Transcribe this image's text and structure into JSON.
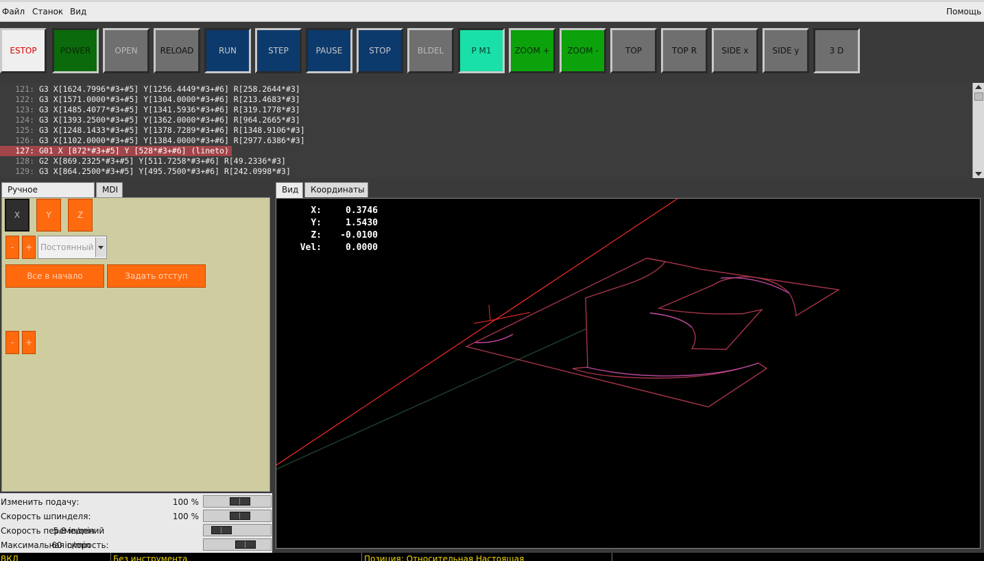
{
  "menu": {
    "file": "Файл",
    "machine": "Станок",
    "view": "Вид",
    "help": "Помощь"
  },
  "toolbar": [
    {
      "label": "ESTOP",
      "bg": "#efefef",
      "fg": "#e00000",
      "sunk": false
    },
    {
      "label": "POWER",
      "bg": "#0b6a0b",
      "fg": "#0a2a0a",
      "sunk": true
    },
    {
      "label": "OPEN",
      "bg": "#6f6f6f",
      "fg": "#b9b9b9",
      "sunk": false
    },
    {
      "label": "RELOAD",
      "bg": "#6f6f6f",
      "fg": "#111111",
      "sunk": false
    },
    {
      "label": "RUN",
      "bg": "#0d3a6d",
      "fg": "#c8c8c8",
      "sunk": true
    },
    {
      "label": "STEP",
      "bg": "#0d3a6d",
      "fg": "#c8c8c8",
      "sunk": false
    },
    {
      "label": "PAUSE",
      "bg": "#0d3a6d",
      "fg": "#c8c8c8",
      "sunk": true
    },
    {
      "label": "STOP",
      "bg": "#0d3a6d",
      "fg": "#c8c8c8",
      "sunk": false
    },
    {
      "label": "BLDEL",
      "bg": "#6f6f6f",
      "fg": "#b9b9b9",
      "sunk": false
    },
    {
      "label": "P M1",
      "bg": "#19e0a8",
      "fg": "#0a3a2a",
      "sunk": true
    },
    {
      "label": "ZOOM +",
      "bg": "#0ca20c",
      "fg": "#0a2a0a",
      "sunk": false
    },
    {
      "label": "ZOOM -",
      "bg": "#0ca20c",
      "fg": "#0a2a0a",
      "sunk": false
    },
    {
      "label": "TOP",
      "bg": "#6f6f6f",
      "fg": "#111111",
      "sunk": false
    },
    {
      "label": "TOP R",
      "bg": "#6f6f6f",
      "fg": "#111111",
      "sunk": false
    },
    {
      "label": "SIDE x",
      "bg": "#6f6f6f",
      "fg": "#111111",
      "sunk": false
    },
    {
      "label": "SIDE y",
      "bg": "#6f6f6f",
      "fg": "#111111",
      "sunk": false
    },
    {
      "label": "3 D",
      "bg": "#6f6f6f",
      "fg": "#111111",
      "sunk": true
    }
  ],
  "gcode": [
    {
      "num": "121:",
      "text": "G3 X[1624.7996*#3+#5] Y[1256.4449*#3+#6] R[258.2644*#3]",
      "active": false
    },
    {
      "num": "122:",
      "text": "G3 X[1571.0000*#3+#5] Y[1304.0000*#3+#6] R[213.4683*#3]",
      "active": false
    },
    {
      "num": "123:",
      "text": "G3 X[1485.4077*#3+#5] Y[1341.5936*#3+#6] R[319.1778*#3]",
      "active": false
    },
    {
      "num": "124:",
      "text": "G3 X[1393.2500*#3+#5] Y[1362.0000*#3+#6] R[964.2665*#3]",
      "active": false
    },
    {
      "num": "125:",
      "text": "G3 X[1248.1433*#3+#5] Y[1378.7289*#3+#6] R[1348.9106*#3]",
      "active": false
    },
    {
      "num": "126:",
      "text": "G3 X[1102.0000*#3+#5] Y[1384.0000*#3+#6] R[2977.6386*#3]",
      "active": false
    },
    {
      "num": "127:",
      "text": "G01 X [872*#3+#5] Y [528*#3+#6] (lineto)",
      "active": true
    },
    {
      "num": "128:",
      "text": "G2 X[869.2325*#3+#5] Y[511.7258*#3+#6] R[49.2336*#3]",
      "active": false
    },
    {
      "num": "129:",
      "text": "G3 X[864.2500*#3+#5] Y[495.7500*#3+#6] R[242.0998*#3]",
      "active": false
    }
  ],
  "left_tabs": {
    "manual": "Ручное управление",
    "mdi": "MDI"
  },
  "jog": {
    "axes": [
      "X",
      "Y",
      "Z"
    ],
    "selected_axis": "X",
    "minus": "-",
    "plus": "+",
    "mode": "Постоянный",
    "home_all": "Все в начало",
    "touch_off": "Задать отступ"
  },
  "sliders": [
    {
      "label": "Изменить подачу:",
      "value": "100 %",
      "pos": 0.58
    },
    {
      "label": "Скорость шпинделя:",
      "value": "100 %",
      "pos": 0.58
    },
    {
      "label": "Скорость перемещений",
      "value": "5.8 in/min",
      "pos": 0.16
    },
    {
      "label": "Максимальная скорость:",
      "value": "60 in/min",
      "pos": 0.7
    }
  ],
  "right_tabs": {
    "view": "Вид",
    "coords": "Координаты"
  },
  "dro": [
    {
      "axis": "X:",
      "value": "0.3746"
    },
    {
      "axis": "Y:",
      "value": "1.5430"
    },
    {
      "axis": "Z:",
      "value": "-0.0100"
    },
    {
      "axis": "Vel:",
      "value": "0.0000"
    }
  ],
  "status": {
    "state": "ВКЛ",
    "tool": "Без инструмента",
    "position": "Позиция: Относительная Настоящая"
  },
  "colors": {
    "orange": "#ff6a0f",
    "jog_panel": "#cfcd9f",
    "highlight": "#a2454a",
    "status_text": "#f2d600"
  }
}
